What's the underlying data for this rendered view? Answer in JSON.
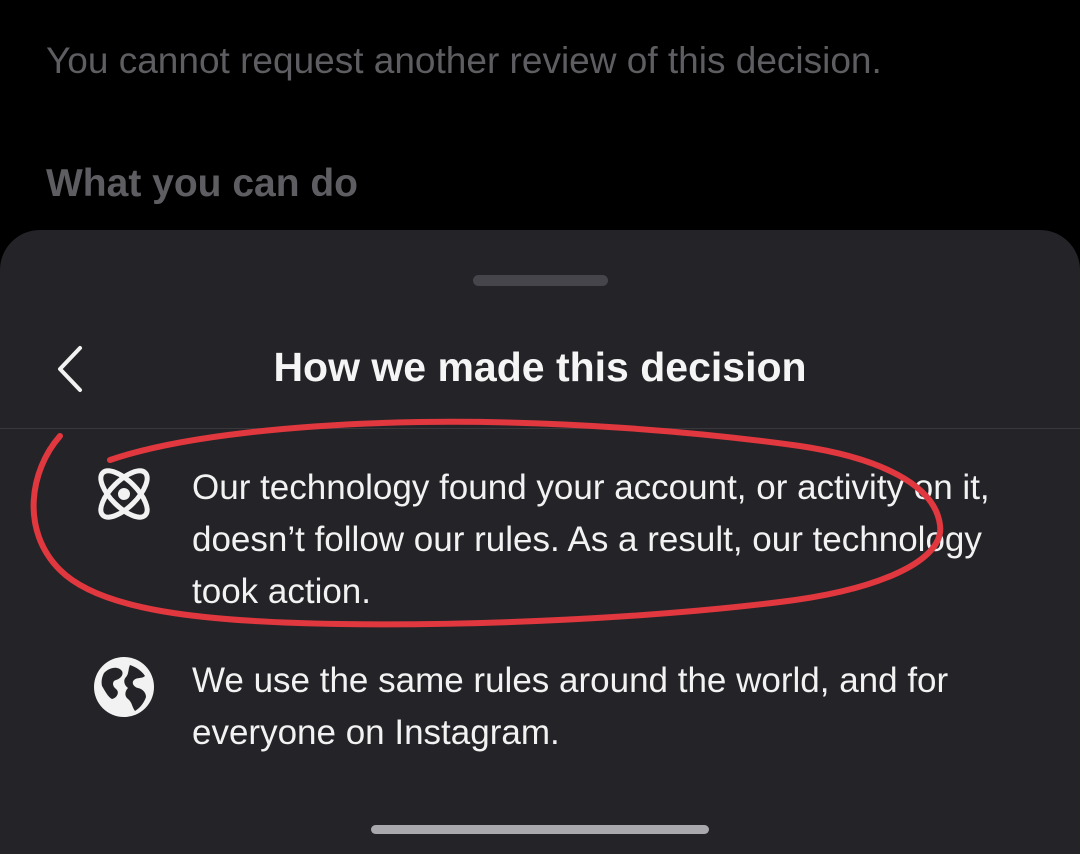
{
  "background": {
    "notice": "You cannot request another review of this decision.",
    "section_heading": "What you can do"
  },
  "sheet": {
    "title": "How we made this decision",
    "back_icon": "chevron-left-icon",
    "items": [
      {
        "icon": "atom-icon",
        "text": "Our technology found your account, or activity on it, doesn’t follow our rules. As a result, our technology took action."
      },
      {
        "icon": "globe-icon",
        "text": "We use the same rules around the world, and for everyone on Instagram."
      }
    ]
  },
  "colors": {
    "sheet_background": "#242428",
    "page_background": "#000000",
    "annotation_stroke": "#e0383e"
  }
}
